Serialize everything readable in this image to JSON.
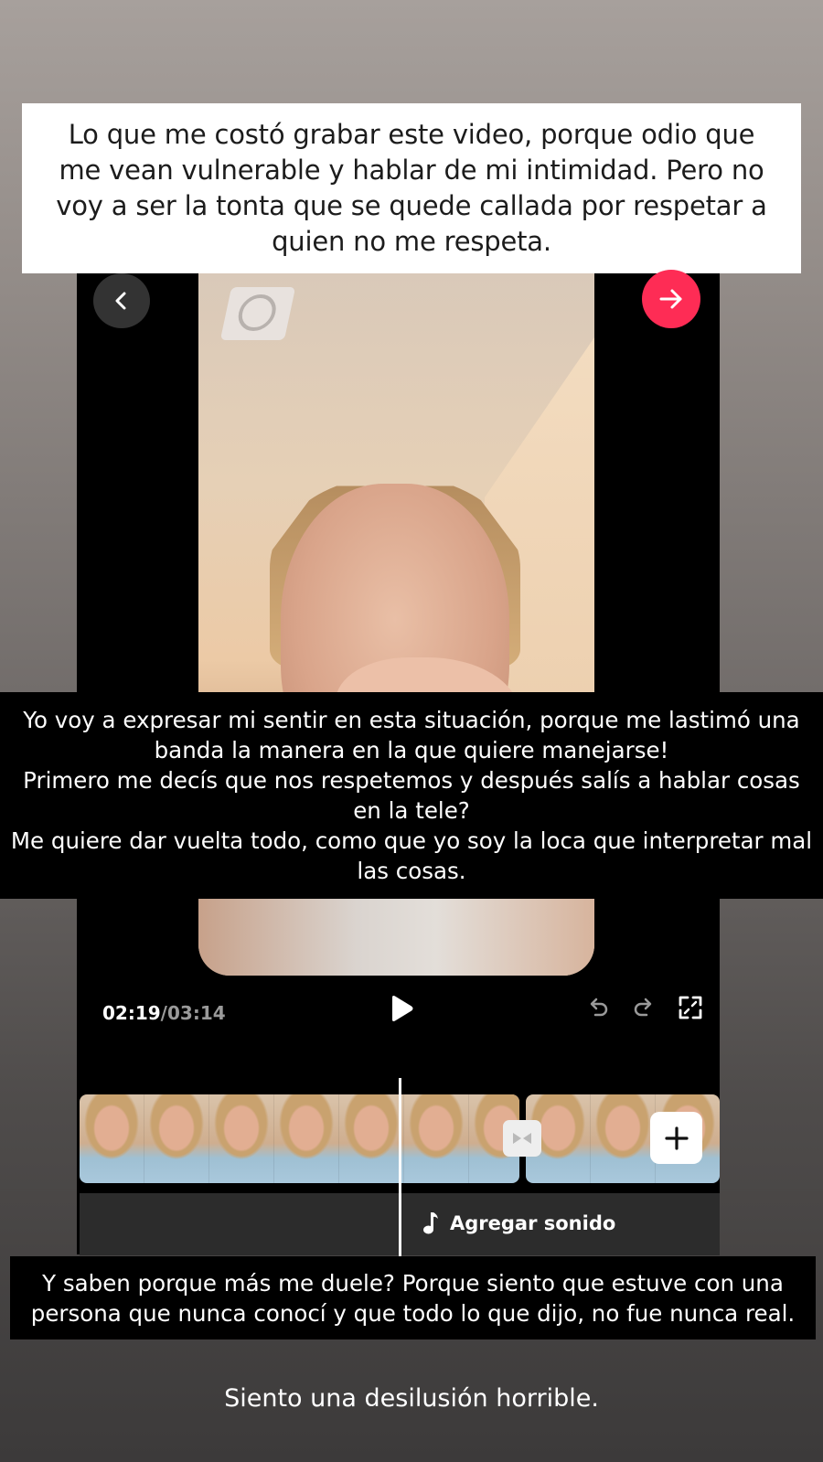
{
  "captions": {
    "top": "Lo que me costó grabar este video, porque odio que me vean vulnerable y hablar de mi intimidad. Pero no voy a ser la tonta que se quede callada por respetar a quien no me respeta.",
    "middle": "Yo voy a expresar mi sentir en esta situación, porque me lastimó una banda la manera en la que quiere manejarse!\nPrimero me decís que nos respetemos y después salís a hablar cosas en la tele?\nMe quiere dar vuelta todo, como que yo soy la loca que interpretar mal las cosas.",
    "bottom": "Y saben porque más me duele? Porque siento que estuve con una\npersona que nunca conocí y que todo lo que dijo, no fue nunca real.",
    "final": "Siento una desilusión horrible."
  },
  "editor": {
    "current_time": "02:19",
    "separator": "/",
    "total_time": "03:14",
    "add_sound_label": "Agregar sonido",
    "icons": {
      "back": "chevron-left-icon",
      "next": "arrow-right-icon",
      "play": "play-icon",
      "undo": "undo-icon",
      "redo": "redo-icon",
      "fullscreen": "fullscreen-icon",
      "transition": "transition-icon",
      "add_clip": "plus-icon",
      "music": "music-note-icon"
    },
    "colors": {
      "accent": "#fe2c55",
      "editor_bg": "#000000",
      "sound_track": "#2c2c2c"
    }
  }
}
